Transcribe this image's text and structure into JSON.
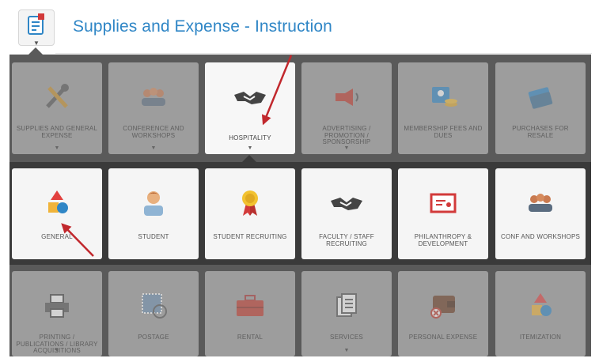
{
  "header": {
    "title": "Supplies and Expense - Instruction"
  },
  "categories": [
    {
      "label": "SUPPLIES AND GENERAL EXPENSE",
      "icon": "tools-icon"
    },
    {
      "label": "CONFERENCE AND WORKSHOPS",
      "icon": "conference-icon"
    },
    {
      "label": "HOSPITALITY",
      "icon": "handshake-icon"
    },
    {
      "label": "ADVERTISING / PROMOTION / SPONSORSHIP",
      "icon": "megaphone-icon"
    },
    {
      "label": "MEMBERSHIP FEES AND DUES",
      "icon": "membership-card-icon"
    },
    {
      "label": "PURCHASES FOR RESALE",
      "icon": "credit-cards-icon"
    }
  ],
  "subcategories": [
    {
      "label": "GENERAL",
      "icon": "shapes-icon"
    },
    {
      "label": "STUDENT",
      "icon": "student-icon"
    },
    {
      "label": "STUDENT RECRUITING",
      "icon": "award-ribbon-icon"
    },
    {
      "label": "FACULTY / STAFF RECRUITING",
      "icon": "handshake-icon"
    },
    {
      "label": "PHILANTHROPY & DEVELOPMENT",
      "icon": "certificate-icon"
    },
    {
      "label": "CONF AND WORKSHOPS",
      "icon": "conference-icon"
    }
  ],
  "more_categories": [
    {
      "label": "PRINTING / PUBLICATIONS / LIBRARY ACQUISITIONS",
      "icon": "printer-icon"
    },
    {
      "label": "POSTAGE",
      "icon": "postage-stamp-icon"
    },
    {
      "label": "RENTAL",
      "icon": "toolbox-icon"
    },
    {
      "label": "SERVICES",
      "icon": "documents-icon"
    },
    {
      "label": "PERSONAL EXPENSE",
      "icon": "wallet-icon"
    },
    {
      "label": "ITEMIZATION",
      "icon": "shapes-icon"
    }
  ],
  "selected_category": "HOSPITALITY",
  "colors": {
    "accent": "#2f86c6",
    "arrow": "#c1282d",
    "panel_dark": "#3a3a3a",
    "panel": "#5a5a5a"
  }
}
